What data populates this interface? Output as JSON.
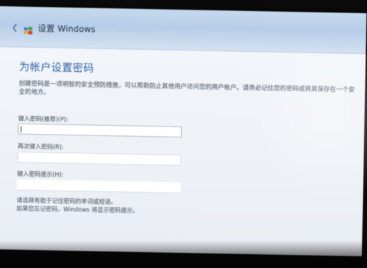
{
  "window": {
    "title": "设置 Windows",
    "back_icon": "back-arrow-icon",
    "app_icon": "windows-setup-icon"
  },
  "page": {
    "title": "为帐户设置密码",
    "description": "创建密码是一项明智的安全预防措施，可以帮助防止其他用户访问您的用户帐户。请务必记住您的密码或将其保存在一个安全的地方。"
  },
  "fields": [
    {
      "label": "键入密码(推荐)(P):",
      "value": "",
      "focused": true
    },
    {
      "label": "再次键入密码(R):",
      "value": "",
      "focused": false
    },
    {
      "label": "键入密码提示(H):",
      "value": "",
      "focused": false
    }
  ],
  "hint": {
    "text": "请选择有助于记住密码的单词或短语。\n如果您忘记密码，Windows 将显示密码提示。"
  },
  "colors": {
    "title_accent": "#2f5fa6",
    "titlebar": "#b7cde8",
    "background": "#eef2f7"
  }
}
